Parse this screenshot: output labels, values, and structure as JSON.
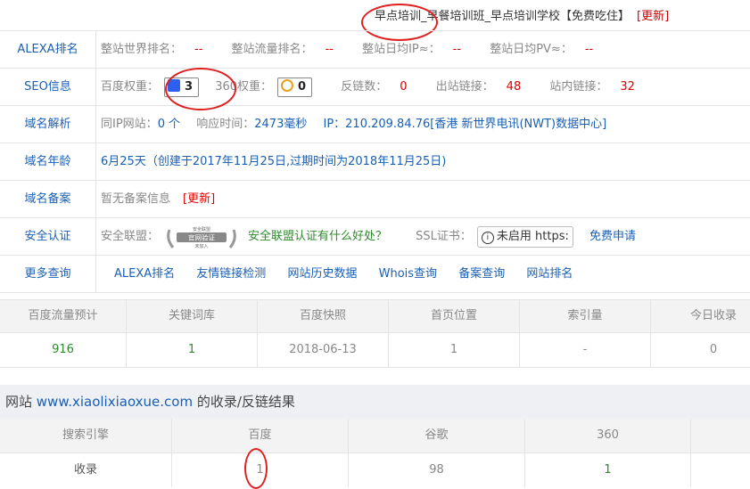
{
  "header": {
    "title": "早点培训_早餐培训班_早点培训学校【免费吃住】",
    "update": "[更新]"
  },
  "rows": {
    "alexa": {
      "label": "ALEXA排名",
      "world_label": "整站世界排名：",
      "world_val": "--",
      "traffic_label": "整站流量排名：",
      "traffic_val": "--",
      "ip_label": "整站日均IP≈：",
      "ip_val": "--",
      "pv_label": "整站日均PV≈：",
      "pv_val": "--"
    },
    "seo": {
      "label": "SEO信息",
      "baidu_label": "百度权重：",
      "baidu_val": "3",
      "q360_label": "360权重：",
      "q360_val": "0",
      "backlinks_label": "反链数：",
      "backlinks_val": "0",
      "out_label": "出站链接：",
      "out_val": "48",
      "in_label": "站内链接：",
      "in_val": "32"
    },
    "dns": {
      "label": "域名解析",
      "sameip_label": "同IP网站：",
      "sameip_val": "0 个",
      "resp_label": "响应时间：",
      "resp_val": "2473毫秒",
      "ip_text": "IP：210.209.84.76[香港 新世界电讯(NWT)数据中心]"
    },
    "age": {
      "label": "域名年龄",
      "text": "6月25天（创建于2017年11月25日,过期时间为2018年11月25日)"
    },
    "icp": {
      "label": "域名备案",
      "text": "暂无备案信息",
      "update": "[更新]"
    },
    "security": {
      "label": "安全认证",
      "alliance_label": "安全联盟：",
      "seal_top": "安全联盟",
      "seal_mid": "官网验证",
      "seal_bottom": "未加入",
      "benefit_link": "安全联盟认证有什么好处？",
      "ssl_label": "SSL证书：",
      "ssl_status": "未启用 https:",
      "apply_link": "免费申请"
    },
    "more": {
      "label": "更多查询",
      "links": [
        "ALEXA排名",
        "友情链接检测",
        "网站历史数据",
        "Whois查询",
        "备案查询",
        "网站排名"
      ]
    }
  },
  "stats": {
    "headers": [
      "百度流量预计",
      "关键词库",
      "百度快照",
      "首页位置",
      "索引量",
      "今日收录"
    ],
    "values": [
      "916",
      "1",
      "2018-06-13",
      "1",
      "-",
      "0"
    ]
  },
  "index_section": {
    "prefix": "网站 ",
    "domain": "www.xiaolixiaoxue.com",
    "suffix": " 的收录/反链结果"
  },
  "index_table": {
    "headers": [
      "搜索引擎",
      "百度",
      "谷歌",
      "360"
    ],
    "row_label": "收录",
    "values": [
      "1",
      "98",
      "1"
    ]
  },
  "colors": {
    "accent": "#1a5fb4",
    "alert": "#dd0000",
    "positive": "#2c8a2c",
    "annotation": "#e02020"
  }
}
